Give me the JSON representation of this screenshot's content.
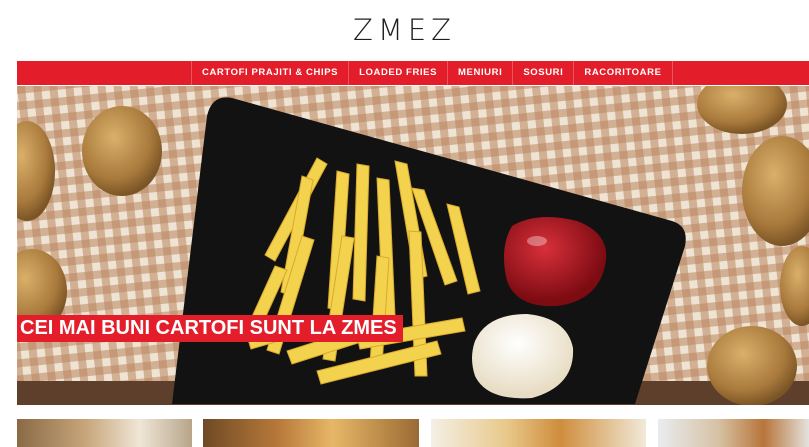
{
  "brand": {
    "logo_text": "ZMEZ"
  },
  "nav": {
    "items": [
      {
        "label": "CARTOFI PRAJITI & CHIPS"
      },
      {
        "label": "LOADED FRIES"
      },
      {
        "label": "MENIURI"
      },
      {
        "label": "SOSURI"
      },
      {
        "label": "RACORITOARE"
      }
    ]
  },
  "hero": {
    "headline": "CEI MAI BUNI CARTOFI SUNT LA ZMES",
    "colors": {
      "accent": "#e31e2a",
      "plate": "#111111",
      "ketchup": "#a8111a",
      "mayo": "#f7f2e3",
      "fries": "#f3d24e"
    }
  },
  "categories": [
    {
      "name": "card-category-1"
    },
    {
      "name": "card-category-2"
    },
    {
      "name": "card-category-3"
    },
    {
      "name": "card-category-4"
    }
  ]
}
